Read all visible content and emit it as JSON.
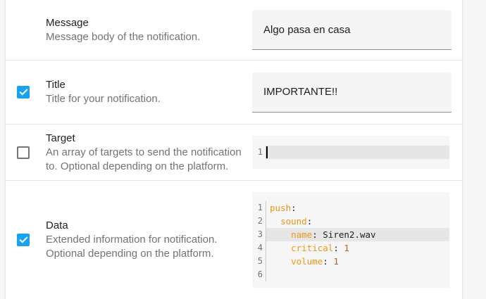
{
  "colors": {
    "accent": "#18a3f2",
    "key": "#ef9616",
    "num": "#b05f2c"
  },
  "rows": [
    {
      "name": "Message",
      "desc": "Message body of the notification.",
      "value": "Algo pasa en casa"
    },
    {
      "name": "Title",
      "desc": "Title for your notification.",
      "checked": true,
      "value": "IMPORTANTE!!"
    },
    {
      "name": "Target",
      "desc": "An array of targets to send the notification to. Optional depending on the platform.",
      "checked": false,
      "lines": [
        {
          "num": "1",
          "active": true,
          "caret": true,
          "tokens": []
        }
      ]
    },
    {
      "name": "Data",
      "desc": "Extended information for notification. Optional depending on the platform.",
      "checked": true,
      "lines": [
        {
          "num": "1",
          "tokens": [
            {
              "t": "key",
              "v": "push"
            },
            {
              "t": "plain",
              "v": ":"
            }
          ]
        },
        {
          "num": "2",
          "tokens": [
            {
              "t": "plain",
              "v": "  "
            },
            {
              "t": "key",
              "v": "sound"
            },
            {
              "t": "plain",
              "v": ":"
            }
          ]
        },
        {
          "num": "3",
          "active": true,
          "tokens": [
            {
              "t": "plain",
              "v": "    "
            },
            {
              "t": "key",
              "v": "name"
            },
            {
              "t": "plain",
              "v": ": Siren2.wav"
            }
          ]
        },
        {
          "num": "4",
          "tokens": [
            {
              "t": "plain",
              "v": "    "
            },
            {
              "t": "key",
              "v": "critical"
            },
            {
              "t": "plain",
              "v": ": "
            },
            {
              "t": "num",
              "v": "1"
            }
          ]
        },
        {
          "num": "5",
          "tokens": [
            {
              "t": "plain",
              "v": "    "
            },
            {
              "t": "key",
              "v": "volume"
            },
            {
              "t": "plain",
              "v": ": "
            },
            {
              "t": "num",
              "v": "1"
            }
          ]
        },
        {
          "num": "6",
          "tokens": []
        }
      ]
    }
  ]
}
